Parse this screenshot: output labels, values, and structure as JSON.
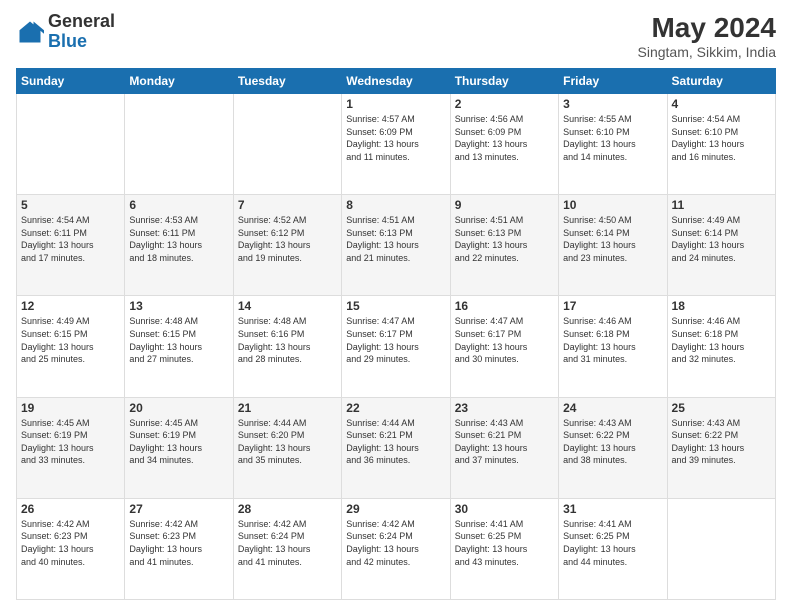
{
  "header": {
    "logo_general": "General",
    "logo_blue": "Blue",
    "month_year": "May 2024",
    "location": "Singtam, Sikkim, India"
  },
  "days_of_week": [
    "Sunday",
    "Monday",
    "Tuesday",
    "Wednesday",
    "Thursday",
    "Friday",
    "Saturday"
  ],
  "weeks": [
    [
      {
        "day": "",
        "info": ""
      },
      {
        "day": "",
        "info": ""
      },
      {
        "day": "",
        "info": ""
      },
      {
        "day": "1",
        "info": "Sunrise: 4:57 AM\nSunset: 6:09 PM\nDaylight: 13 hours\nand 11 minutes."
      },
      {
        "day": "2",
        "info": "Sunrise: 4:56 AM\nSunset: 6:09 PM\nDaylight: 13 hours\nand 13 minutes."
      },
      {
        "day": "3",
        "info": "Sunrise: 4:55 AM\nSunset: 6:10 PM\nDaylight: 13 hours\nand 14 minutes."
      },
      {
        "day": "4",
        "info": "Sunrise: 4:54 AM\nSunset: 6:10 PM\nDaylight: 13 hours\nand 16 minutes."
      }
    ],
    [
      {
        "day": "5",
        "info": "Sunrise: 4:54 AM\nSunset: 6:11 PM\nDaylight: 13 hours\nand 17 minutes."
      },
      {
        "day": "6",
        "info": "Sunrise: 4:53 AM\nSunset: 6:11 PM\nDaylight: 13 hours\nand 18 minutes."
      },
      {
        "day": "7",
        "info": "Sunrise: 4:52 AM\nSunset: 6:12 PM\nDaylight: 13 hours\nand 19 minutes."
      },
      {
        "day": "8",
        "info": "Sunrise: 4:51 AM\nSunset: 6:13 PM\nDaylight: 13 hours\nand 21 minutes."
      },
      {
        "day": "9",
        "info": "Sunrise: 4:51 AM\nSunset: 6:13 PM\nDaylight: 13 hours\nand 22 minutes."
      },
      {
        "day": "10",
        "info": "Sunrise: 4:50 AM\nSunset: 6:14 PM\nDaylight: 13 hours\nand 23 minutes."
      },
      {
        "day": "11",
        "info": "Sunrise: 4:49 AM\nSunset: 6:14 PM\nDaylight: 13 hours\nand 24 minutes."
      }
    ],
    [
      {
        "day": "12",
        "info": "Sunrise: 4:49 AM\nSunset: 6:15 PM\nDaylight: 13 hours\nand 25 minutes."
      },
      {
        "day": "13",
        "info": "Sunrise: 4:48 AM\nSunset: 6:15 PM\nDaylight: 13 hours\nand 27 minutes."
      },
      {
        "day": "14",
        "info": "Sunrise: 4:48 AM\nSunset: 6:16 PM\nDaylight: 13 hours\nand 28 minutes."
      },
      {
        "day": "15",
        "info": "Sunrise: 4:47 AM\nSunset: 6:17 PM\nDaylight: 13 hours\nand 29 minutes."
      },
      {
        "day": "16",
        "info": "Sunrise: 4:47 AM\nSunset: 6:17 PM\nDaylight: 13 hours\nand 30 minutes."
      },
      {
        "day": "17",
        "info": "Sunrise: 4:46 AM\nSunset: 6:18 PM\nDaylight: 13 hours\nand 31 minutes."
      },
      {
        "day": "18",
        "info": "Sunrise: 4:46 AM\nSunset: 6:18 PM\nDaylight: 13 hours\nand 32 minutes."
      }
    ],
    [
      {
        "day": "19",
        "info": "Sunrise: 4:45 AM\nSunset: 6:19 PM\nDaylight: 13 hours\nand 33 minutes."
      },
      {
        "day": "20",
        "info": "Sunrise: 4:45 AM\nSunset: 6:19 PM\nDaylight: 13 hours\nand 34 minutes."
      },
      {
        "day": "21",
        "info": "Sunrise: 4:44 AM\nSunset: 6:20 PM\nDaylight: 13 hours\nand 35 minutes."
      },
      {
        "day": "22",
        "info": "Sunrise: 4:44 AM\nSunset: 6:21 PM\nDaylight: 13 hours\nand 36 minutes."
      },
      {
        "day": "23",
        "info": "Sunrise: 4:43 AM\nSunset: 6:21 PM\nDaylight: 13 hours\nand 37 minutes."
      },
      {
        "day": "24",
        "info": "Sunrise: 4:43 AM\nSunset: 6:22 PM\nDaylight: 13 hours\nand 38 minutes."
      },
      {
        "day": "25",
        "info": "Sunrise: 4:43 AM\nSunset: 6:22 PM\nDaylight: 13 hours\nand 39 minutes."
      }
    ],
    [
      {
        "day": "26",
        "info": "Sunrise: 4:42 AM\nSunset: 6:23 PM\nDaylight: 13 hours\nand 40 minutes."
      },
      {
        "day": "27",
        "info": "Sunrise: 4:42 AM\nSunset: 6:23 PM\nDaylight: 13 hours\nand 41 minutes."
      },
      {
        "day": "28",
        "info": "Sunrise: 4:42 AM\nSunset: 6:24 PM\nDaylight: 13 hours\nand 41 minutes."
      },
      {
        "day": "29",
        "info": "Sunrise: 4:42 AM\nSunset: 6:24 PM\nDaylight: 13 hours\nand 42 minutes."
      },
      {
        "day": "30",
        "info": "Sunrise: 4:41 AM\nSunset: 6:25 PM\nDaylight: 13 hours\nand 43 minutes."
      },
      {
        "day": "31",
        "info": "Sunrise: 4:41 AM\nSunset: 6:25 PM\nDaylight: 13 hours\nand 44 minutes."
      },
      {
        "day": "",
        "info": ""
      }
    ]
  ]
}
